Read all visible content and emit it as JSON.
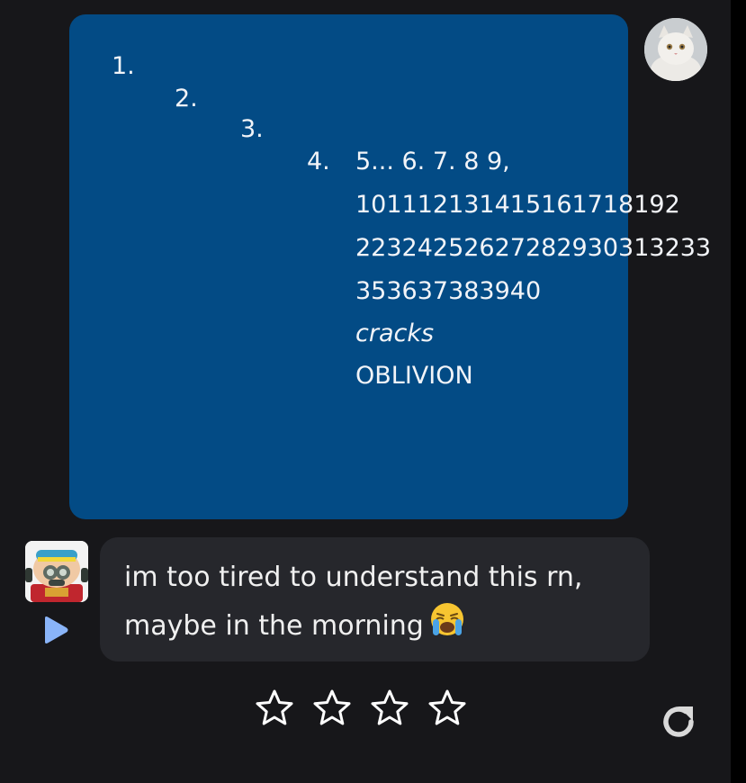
{
  "user_message": {
    "numbers": [
      "1.",
      "2.",
      "3.",
      "4."
    ],
    "item4_first": "5... 6. 7. 8 9,",
    "item4_overflow_lines": [
      "101112131415161718192",
      "22324252627282930313233"
    ],
    "item4_tail_lines": [
      "353637383940"
    ],
    "item4_italic": "cracks",
    "item4_last": "OBLIVION",
    "bubble_color": "#034b85"
  },
  "bot_message": {
    "text_line1": "im too tired to understand this rn,",
    "text_line2": "maybe in the morning",
    "emoji": "loudly-crying-face-emoji"
  },
  "rating": {
    "stars": 4,
    "selected": 0
  },
  "colors": {
    "background": "#17171a",
    "bot_bubble": "#26272c",
    "play_accent": "#8ab4f8"
  },
  "icons": {
    "rating": "star-outline-icon",
    "regenerate": "refresh-icon",
    "play": "play-icon"
  }
}
